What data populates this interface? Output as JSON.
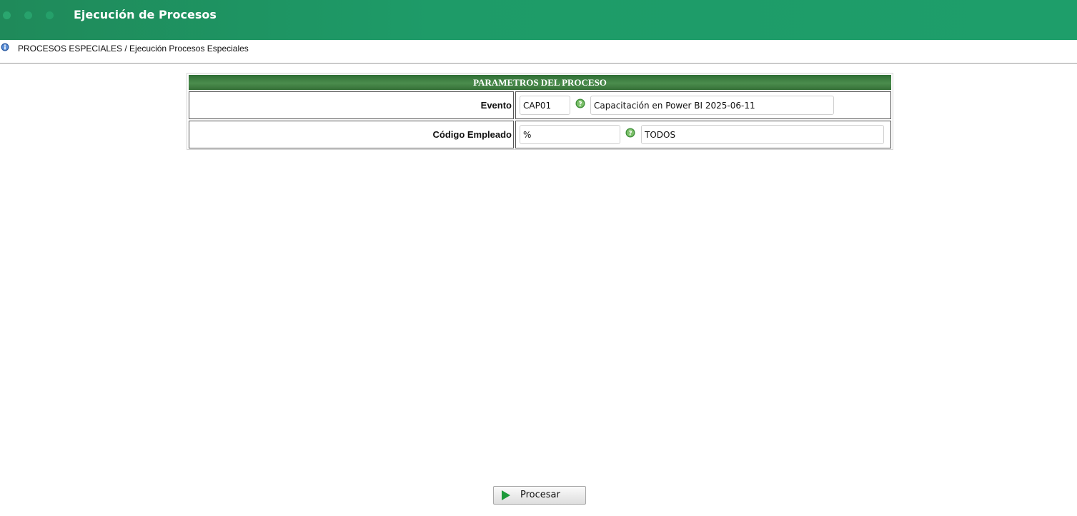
{
  "header": {
    "title": "Ejecución de Procesos",
    "colors": {
      "bar": "#1e9b68",
      "dot": "#2aa66f"
    }
  },
  "breadcrumb": {
    "icon": "info-icon",
    "text": "PROCESOS ESPECIALES / Ejecución Procesos Especiales"
  },
  "params": {
    "title": "PARAMETROS DEL PROCESO",
    "evento": {
      "label": "Evento",
      "code": "CAP01",
      "description": "Capacitación en Power BI 2025-06-11",
      "help_icon": "help-icon"
    },
    "empleado": {
      "label": "Código Empleado",
      "code": "%",
      "description": "TODOS",
      "help_icon": "help-icon"
    }
  },
  "actions": {
    "process_label": "Procesar",
    "process_icon": "play-icon"
  }
}
